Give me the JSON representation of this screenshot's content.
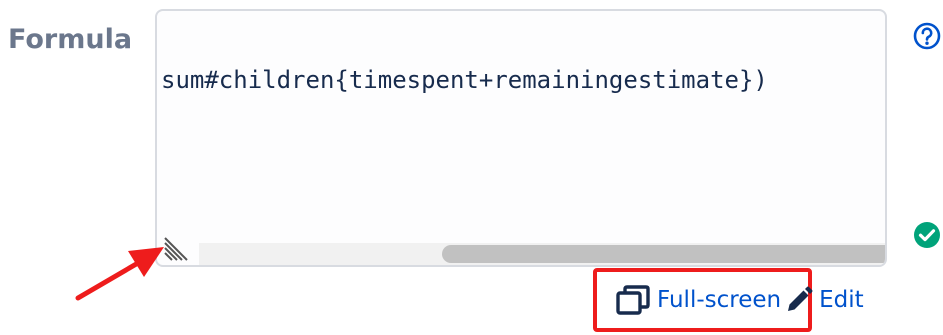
{
  "field": {
    "label": "Formula",
    "value": "sum#children{timespent+remainingestimate})"
  },
  "actions": {
    "fullscreen_label": "Full-screen",
    "edit_label": "Edit"
  },
  "icons": {
    "help": "question-circle-icon",
    "status": "check-circle-icon",
    "fullscreen": "window-restore-icon",
    "edit": "pencil-icon",
    "resize": "resize-handle-icon"
  },
  "colors": {
    "label": "#6b778c",
    "link": "#0052cc",
    "success": "#00a37a",
    "annotation": "#ee1c1c",
    "text": "#172b4d"
  }
}
